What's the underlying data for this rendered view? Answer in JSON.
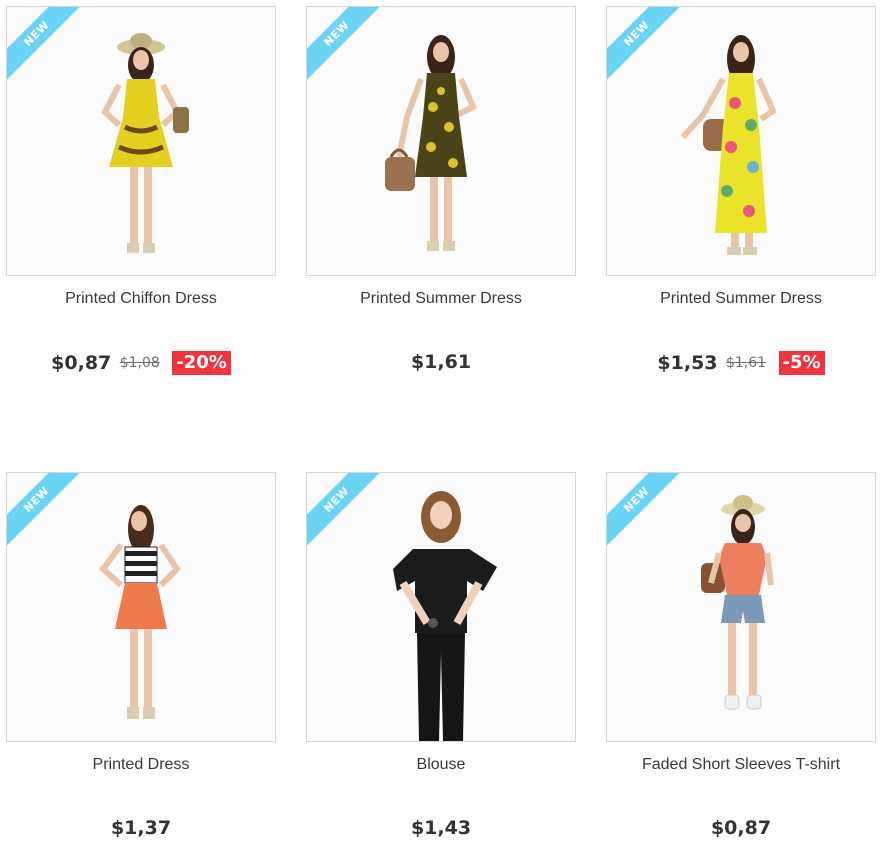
{
  "badge_label": "NEW",
  "colors": {
    "ribbon": "#6ad4f5",
    "discount_bg": "#f13340",
    "border": "#d6d4d4",
    "price_text": "#333333"
  },
  "products": [
    {
      "name": "Printed Chiffon Dress",
      "price": "$0,87",
      "old_price": "$1,08",
      "discount": "-20%",
      "image": "model-yellow-chiffon-dress-with-hat"
    },
    {
      "name": "Printed Summer Dress",
      "price": "$1,61",
      "old_price": "",
      "discount": "",
      "image": "model-yellow-black-print-dress-with-bag"
    },
    {
      "name": "Printed Summer Dress",
      "price": "$1,53",
      "old_price": "$1,61",
      "discount": "-5%",
      "image": "model-yellow-floral-maxi-dress-with-bag"
    },
    {
      "name": "Printed Dress",
      "price": "$1,37",
      "old_price": "",
      "discount": "",
      "image": "model-striped-top-orange-skirt"
    },
    {
      "name": "Blouse",
      "price": "$1,43",
      "old_price": "",
      "discount": "",
      "image": "model-black-ruffle-blouse"
    },
    {
      "name": "Faded Short Sleeves T-shirt",
      "price": "$0,87",
      "old_price": "",
      "discount": "",
      "image": "model-orange-tshirt-denim-shorts-hat"
    }
  ]
}
